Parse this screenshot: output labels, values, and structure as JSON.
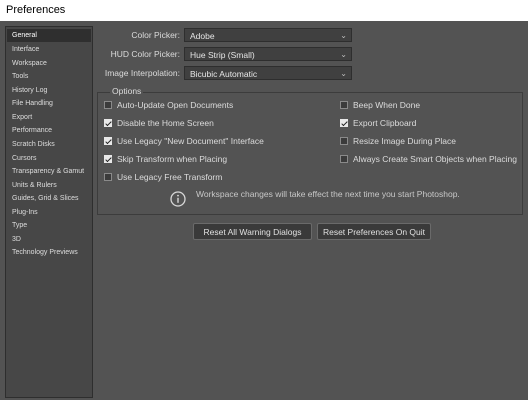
{
  "window": {
    "title": "Preferences"
  },
  "sidebar": {
    "items": [
      {
        "label": "General"
      },
      {
        "label": "Interface"
      },
      {
        "label": "Workspace"
      },
      {
        "label": "Tools"
      },
      {
        "label": "History Log"
      },
      {
        "label": "File Handling"
      },
      {
        "label": "Export"
      },
      {
        "label": "Performance"
      },
      {
        "label": "Scratch Disks"
      },
      {
        "label": "Cursors"
      },
      {
        "label": "Transparency & Gamut"
      },
      {
        "label": "Units & Rulers"
      },
      {
        "label": "Guides, Grid & Slices"
      },
      {
        "label": "Plug-Ins"
      },
      {
        "label": "Type"
      },
      {
        "label": "3D"
      },
      {
        "label": "Technology Previews"
      }
    ],
    "selected": "General"
  },
  "settings": {
    "color_picker": {
      "label": "Color Picker:",
      "value": "Adobe"
    },
    "hud_color_picker": {
      "label": "HUD Color Picker:",
      "value": "Hue Strip (Small)"
    },
    "image_interpolation": {
      "label": "Image Interpolation:",
      "value": "Bicubic Automatic"
    }
  },
  "options": {
    "title": "Options",
    "left": [
      {
        "label": "Auto-Update Open Documents",
        "checked": false
      },
      {
        "label": "Disable the Home Screen",
        "checked": true
      },
      {
        "label": "Use Legacy \"New Document\" Interface",
        "checked": true
      },
      {
        "label": "Skip Transform when Placing",
        "checked": true
      },
      {
        "label": "Use Legacy Free Transform",
        "checked": false
      }
    ],
    "right": [
      {
        "label": "Beep When Done",
        "checked": false
      },
      {
        "label": "Export Clipboard",
        "checked": true
      },
      {
        "label": "Resize Image During Place",
        "checked": false
      },
      {
        "label": "Always Create Smart Objects when Placing",
        "checked": false
      }
    ],
    "notice": "Workspace changes will take effect the next time you start Photoshop."
  },
  "buttons": {
    "reset_warnings": "Reset All Warning Dialogs",
    "reset_prefs": "Reset Preferences On Quit"
  },
  "icons": {
    "dropdown": "chevron-down-icon",
    "info": "info-icon",
    "checkbox": "checkbox-icon"
  }
}
